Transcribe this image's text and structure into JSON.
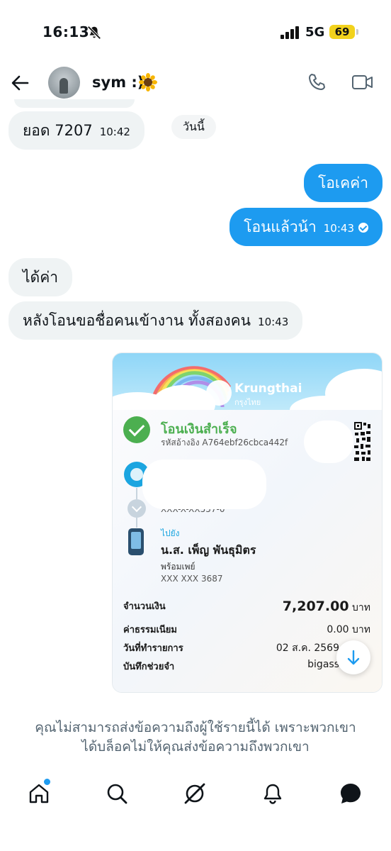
{
  "status_bar": {
    "time": "16:13",
    "network": "5G",
    "battery": "69",
    "icons": [
      "bell-off-icon",
      "signal-icon",
      "battery-icon"
    ]
  },
  "header": {
    "contact_name": "sym :)",
    "emoji": "sunflower",
    "icons": [
      "back-arrow-icon",
      "phone-icon",
      "video-icon"
    ]
  },
  "messages": [
    {
      "dir": "in",
      "text": "ยอด 7207",
      "time": "10:42"
    },
    {
      "dir": "out",
      "text": "โอเคค่า",
      "time": ""
    },
    {
      "dir": "out",
      "text": "โอนแล้วน้า",
      "time": "10:43"
    },
    {
      "dir": "in",
      "text": "ได้ค่า",
      "time": ""
    },
    {
      "dir": "in",
      "text": "หลังโอนขอชื่อคนเข้างาน ทั้งสองคน",
      "time": "10:43"
    }
  ],
  "date_divider": "วันนี้",
  "receipt": {
    "bank_name": "Krungthai",
    "bank_name_th": "กรุงไทย",
    "status": "โอนเงินสำเร็จ",
    "reference": "รหัสอ้างอิง A764ebf26cbca442f",
    "from_account_masked": "XXX-X-XX557-0",
    "to_label": "ไปยัง",
    "recipient_name": "น.ส. เพ็ญ พันธุมิตร",
    "recipient_service": "พร้อมเพย์",
    "recipient_account": "XXX XXX 3687",
    "rows": [
      {
        "label": "จำนวนเงิน",
        "value": "7,207.00",
        "unit": "บาท"
      },
      {
        "label": "ค่าธรรมเนียม",
        "value": "0.00 บาท"
      },
      {
        "label": "วันที่ทำรายการ",
        "value": "02 ส.ค. 2569"
      },
      {
        "label": "บันทึกช่วยจำ",
        "value": "bigass"
      }
    ],
    "colors": {
      "success": "#4caf50",
      "brand": "#1ba5e0"
    }
  },
  "blocked_notice": {
    "line1": "คุณไม่สามารถส่งข้อความถึงผู้ใช้รายนี้ได้ เพราะพวกเขา",
    "line2": "ได้บล็อคไม่ให้คุณส่งข้อความถึงพวกเขา"
  },
  "tabbar": {
    "items": [
      "home-icon",
      "search-icon",
      "grok-icon",
      "notifications-icon",
      "messages-icon"
    ],
    "active": "messages-icon",
    "accent": "#1d9bf0"
  }
}
